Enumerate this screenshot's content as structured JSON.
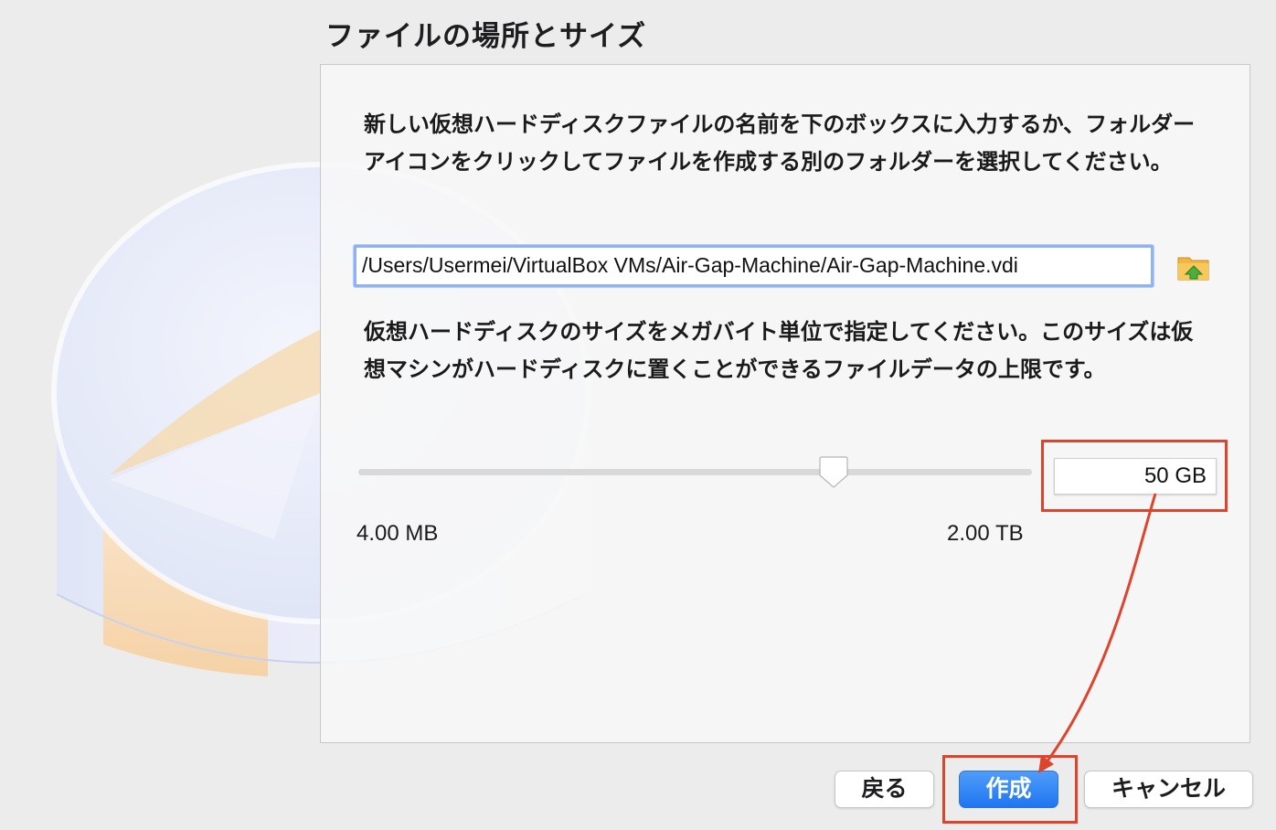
{
  "dialog": {
    "title": "ファイルの場所とサイズ",
    "location_description": "新しい仮想ハードディスクファイルの名前を下のボックスに入力するか、フォルダーアイコンをクリックしてファイルを作成する別のフォルダーを選択してください。",
    "file_path": "/Users/Usermei/VirtualBox VMs/Air-Gap-Machine/Air-Gap-Machine.vdi",
    "size_description": "仮想ハードディスクのサイズをメガバイト単位で指定してください。このサイズは仮想マシンがハードディスクに置くことができるファイルデータの上限です。",
    "size_value": "50 GB",
    "size_min_label": "4.00 MB",
    "size_max_label": "2.00 TB",
    "slider_fraction": 0.705,
    "folder_icon": "folder-icon"
  },
  "buttons": {
    "back": "戻る",
    "create": "作成",
    "cancel": "キャンセル"
  },
  "colors": {
    "accent": "#1f76f0",
    "annotation": "#e0432b",
    "focus": "#8eb2f5"
  }
}
